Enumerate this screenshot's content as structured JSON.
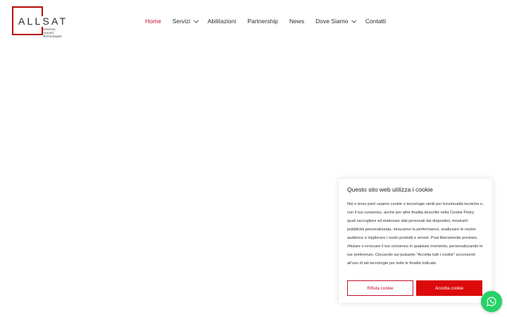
{
  "logo": {
    "word": "ALLSAT",
    "tagline": [
      "Services",
      "Around",
      "Technologies"
    ]
  },
  "nav": {
    "items": [
      {
        "label": "Home",
        "active": true
      },
      {
        "label": "Servizi",
        "dropdown": true
      },
      {
        "label": "Abilitazioni"
      },
      {
        "label": "Partnership"
      },
      {
        "label": "News"
      },
      {
        "label": "Dove Siamo",
        "dropdown": true
      },
      {
        "label": "Contatti"
      }
    ]
  },
  "cookie": {
    "title": "Questo sito web utilizza i cookie",
    "text": "Noi e terze parti usiamo cookie o tecnologie simili per funzionalità tecniche e, con il tuo consenso, anche per altre finalità descritte nella Cookie Policy quali raccogliere ed elaborare dati personali dai dispositivi, mostrarti pubblicità personalizzata, misurarne la performance, analizzare le nostre audience e migliorare i nostri prodotti e servizi. Puoi liberamente prestare, rifiutare o revocare il tuo consenso in qualsiasi momento, personalizzando le tue preferenze. Cliccando sul pulsante \"Accetta tutti i cookie\" acconsenti all'uso di tali tecnologie per tutte le finalità indicate.",
    "reject_label": "Rifiuta cookie",
    "accept_label": "Accetta cookie"
  },
  "colors": {
    "accent": "#c8102e",
    "accept_button": "#dc0a0a",
    "whatsapp": "#25d366"
  },
  "icons": {
    "whatsapp": "whatsapp-icon",
    "dropdown": "chevron-down-icon"
  }
}
